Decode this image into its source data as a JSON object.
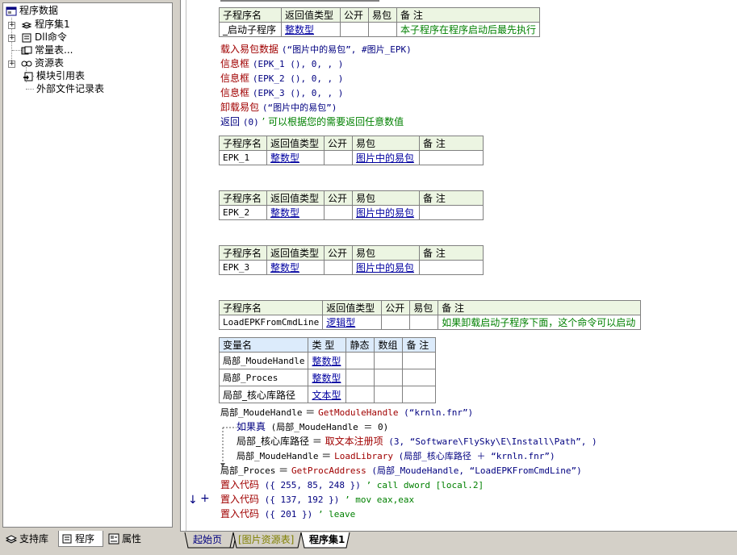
{
  "tree": {
    "root": "程序数据",
    "items": [
      {
        "label": "程序集1",
        "icon": "assembly-icon",
        "expander": "+"
      },
      {
        "label": "Dll命令",
        "icon": "dll-icon",
        "expander": "+"
      },
      {
        "label": "常量表...",
        "icon": "constant-icon",
        "expander": ""
      },
      {
        "label": "资源表",
        "icon": "resource-icon",
        "expander": "+"
      },
      {
        "label": "模块引用表",
        "icon": "module-icon",
        "expander": ""
      },
      {
        "label": "外部文件记录表",
        "icon": "external-file-icon",
        "expander": ""
      }
    ]
  },
  "left_tabs": [
    {
      "label": "支持库",
      "icon": "library-icon"
    },
    {
      "label": "程序",
      "icon": "program-icon"
    },
    {
      "label": "属性",
      "icon": "property-icon"
    }
  ],
  "headers": {
    "sub_name": "子程序名",
    "ret_type": "返回值类型",
    "public": "公开",
    "epk": "易包",
    "remark": "备 注",
    "var_name": "变量名",
    "type": "类 型",
    "static": "静态",
    "array": "数组"
  },
  "subs": {
    "s0": {
      "name": "_启动子程序",
      "ret": "整数型",
      "epk": "",
      "remark": "本子程序在程序启动后最先执行"
    },
    "s1": {
      "name": "EPK_1",
      "ret": "整数型",
      "epk": "图片中的易包",
      "remark": ""
    },
    "s2": {
      "name": "EPK_2",
      "ret": "整数型",
      "epk": "图片中的易包",
      "remark": ""
    },
    "s3": {
      "name": "EPK_3",
      "ret": "整数型",
      "epk": "图片中的易包",
      "remark": ""
    },
    "s4": {
      "name": "LoadEPKFromCmdLine",
      "ret": "逻辑型",
      "epk": "",
      "remark": "如果卸载启动子程序下面，这个命令可以启动"
    }
  },
  "vars": [
    {
      "name": "局部_MoudeHandle",
      "type": "整数型"
    },
    {
      "name": "局部_Proces",
      "type": "整数型"
    },
    {
      "name": "局部_核心库路径",
      "type": "文本型"
    }
  ],
  "code_a": {
    "l1_cmd": "载入易包数据",
    "l1_arg": "(“图片中的易包”, #图片_EPK)",
    "l2_cmd": "信息框",
    "l2_arg": "(EPK_1 (), 0, , )",
    "l3_cmd": "信息框",
    "l3_arg": "(EPK_2 (), 0, , )",
    "l4_cmd": "信息框",
    "l4_arg": "(EPK_3 (), 0, , )",
    "l5_cmd": "卸载易包",
    "l5_arg": "(“图片中的易包”)",
    "l6_cmd": "返回",
    "l6_arg": "(0)",
    "l6_cmt": "’ 可以根据您的需要返回任意数值"
  },
  "code_b": {
    "l1_var": "局部_MoudeHandle",
    "l1_eq": " ＝ ",
    "l1_fn": "GetModuleHandle",
    "l1_arg": " (“krnln.fnr”)",
    "l2_kw": "如果真",
    "l2_arg": " (局部_MoudeHandle ＝ 0)",
    "l3_var": "局部_核心库路径",
    "l3_eq": " ＝ ",
    "l3_fn": "取文本注册项",
    "l3_arg": " (3, “Software\\FlySky\\E\\Install\\Path”, )",
    "l4_var": "局部_MoudeHandle",
    "l4_eq": " ＝ ",
    "l4_fn": "LoadLibrary",
    "l4_arg": " (局部_核心库路径 ＋ “krnln.fnr”)",
    "l5_var": "局部_Proces",
    "l5_eq": " ＝ ",
    "l5_fn": "GetProcAddress",
    "l5_arg": " (局部_MoudeHandle, “LoadEPKFromCmdLine”)",
    "l6_cmd": "置入代码",
    "l6_arg": " ({ 255, 85, 248 })",
    "l6_cmt": " ’ call dword [local.2]",
    "l7_cmd": "置入代码",
    "l7_arg": " ({ 137, 192 })",
    "l7_cmt": " ’ mov eax,eax",
    "l8_cmd": "置入代码",
    "l8_arg": " ({ 201 })",
    "l8_cmt": " ’ leave"
  },
  "bottom_tabs": [
    {
      "label": "起始页",
      "color": "#000080"
    },
    {
      "label": "[图片资源表]",
      "color": "#808000"
    },
    {
      "label": "程序集1",
      "color": "#000000"
    }
  ]
}
